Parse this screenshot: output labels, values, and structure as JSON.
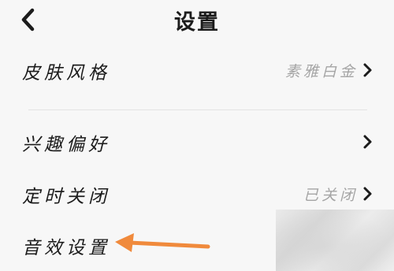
{
  "header": {
    "title": "设置",
    "back_icon": "chevron-left-icon"
  },
  "settings": {
    "skin": {
      "label": "皮肤风格",
      "value": "素雅白金"
    },
    "interest": {
      "label": "兴趣偏好"
    },
    "timer": {
      "label": "定时关闭",
      "value": "已关闭"
    },
    "sound": {
      "label": "音效设置"
    }
  },
  "annotation": {
    "arrow_color": "#f08a3c",
    "arrow_icon": "arrow-left-icon"
  }
}
